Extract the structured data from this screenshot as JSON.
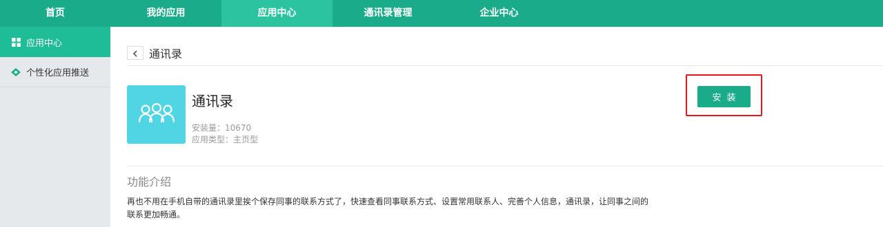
{
  "topnav": {
    "items": [
      {
        "label": "首页"
      },
      {
        "label": "我的应用"
      },
      {
        "label": "应用中心"
      },
      {
        "label": "通讯录管理"
      },
      {
        "label": "企业中心"
      }
    ]
  },
  "sidebar": {
    "items": [
      {
        "label": "应用中心",
        "icon": "grid-icon"
      },
      {
        "label": "个性化应用推送",
        "icon": "diamond-tag-icon"
      }
    ]
  },
  "breadcrumb": {
    "title": "通讯录",
    "back_icon": "chevron-left-icon"
  },
  "app": {
    "name": "通讯录",
    "icon": "people-group-icon",
    "install_count": "安装量：10670",
    "type": "应用类型：主页型",
    "install_label": "安装"
  },
  "intro": {
    "title": "功能介绍",
    "text": "再也不用在手机自带的通讯录里挨个保存同事的联系方式了，快速查看同事联系方式、设置常用联系人、完善个人信息，通讯录，让同事之间的联系更加畅通。"
  },
  "colors": {
    "accent": "#1aab8a",
    "active_tab": "#2bc3a0",
    "app_icon_bg": "#4fd5e4",
    "highlight": "#e8141b"
  }
}
